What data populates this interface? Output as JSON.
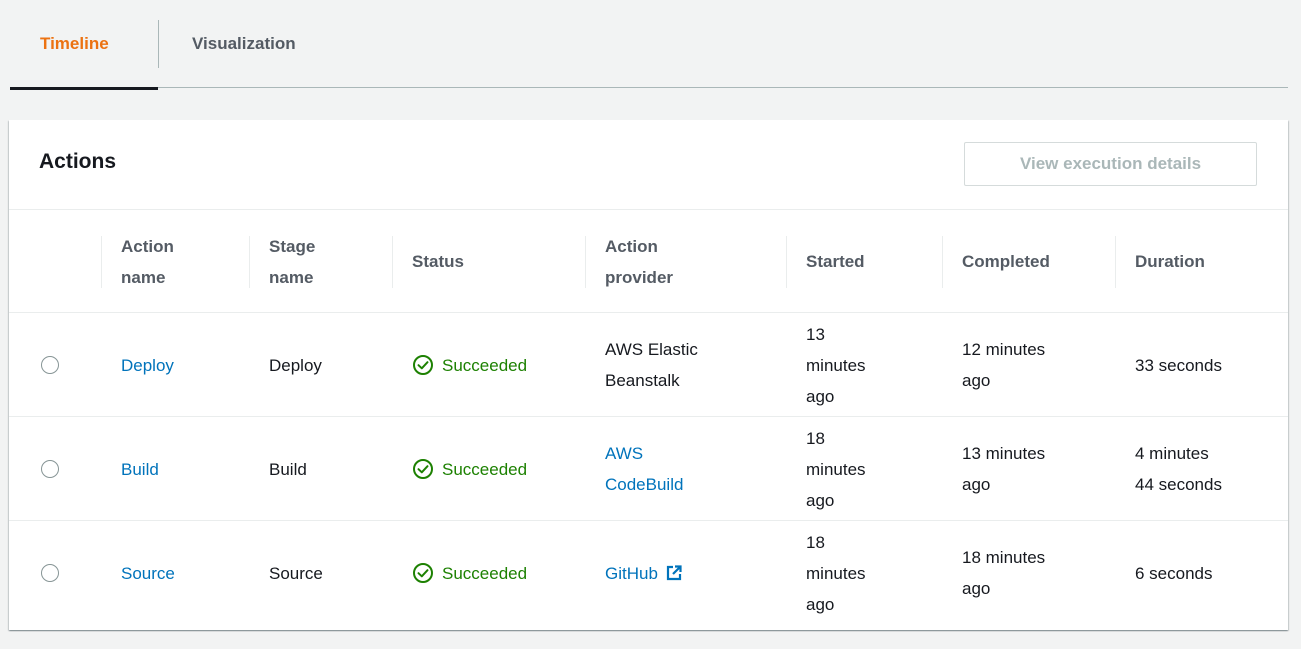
{
  "tabs": [
    {
      "label": "Timeline",
      "active": true
    },
    {
      "label": "Visualization",
      "active": false
    }
  ],
  "panel": {
    "title": "Actions",
    "view_details_label": "View execution details"
  },
  "columns": [
    "Action\nname",
    "Stage\nname",
    "Status",
    "Action\nprovider",
    "Started",
    "Completed",
    "Duration"
  ],
  "rows": [
    {
      "action_name": "Deploy",
      "stage_name": "Deploy",
      "status": "Succeeded",
      "provider": "AWS Elastic\nBeanstalk",
      "provider_link": false,
      "started": "13\nminutes\nago",
      "completed": "12 minutes\nago",
      "duration": "33 seconds"
    },
    {
      "action_name": "Build",
      "stage_name": "Build",
      "status": "Succeeded",
      "provider": "AWS\nCodeBuild",
      "provider_link": true,
      "started": "18\nminutes\nago",
      "completed": "13 minutes\nago",
      "duration": "4 minutes\n44 seconds"
    },
    {
      "action_name": "Source",
      "stage_name": "Source",
      "status": "Succeeded",
      "provider": "GitHub",
      "provider_link": true,
      "started": "18\nminutes\nago",
      "completed": "18 minutes\nago",
      "duration": "6 seconds"
    }
  ],
  "colors": {
    "accent_orange": "#ec7211",
    "link_blue": "#0073bb",
    "success_green": "#1d8102"
  },
  "icons": {
    "status": "check-circle-icon",
    "external_link": "external-link-icon"
  }
}
